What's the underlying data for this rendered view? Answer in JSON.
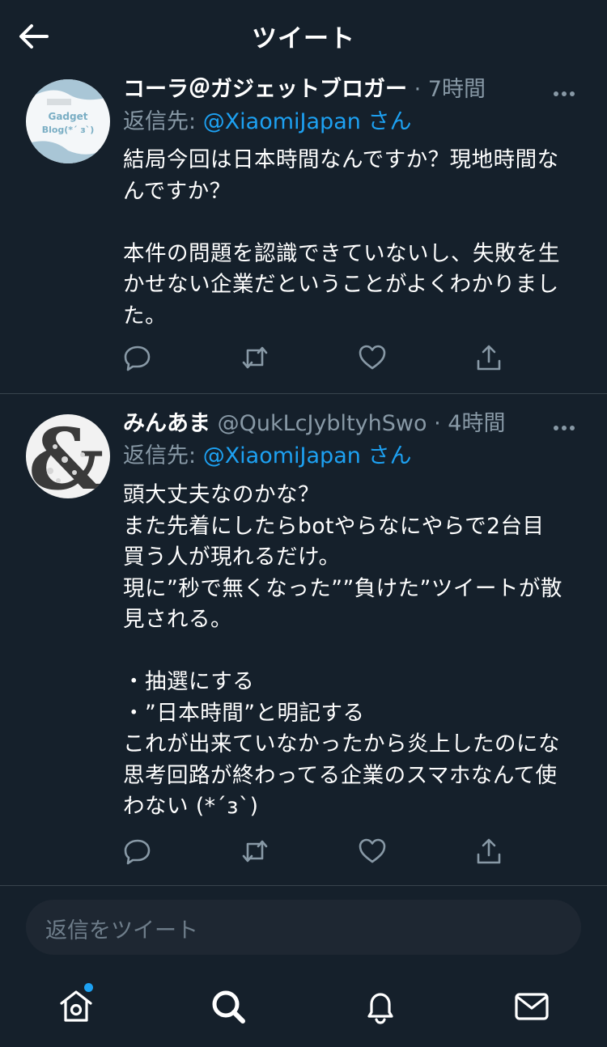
{
  "header": {
    "title": "ツイート"
  },
  "tweets": [
    {
      "name": "コーラ＠ガジェットブロガー",
      "handle": "",
      "dot": "·",
      "time": "7時間",
      "avatar_text": [
        "Gadget",
        "Blog(*´ з`)"
      ],
      "reply_prefix": "返信先: ",
      "reply_mention": "@XiaomiJapan",
      "reply_suffix": "さん",
      "lines": [
        "結局今回は日本時間なんですか？現地時間な",
        "んですか？",
        "",
        "本件の問題を認識できていないし、失敗を生",
        "かせない企業だということがよくわかりまし",
        "た。"
      ]
    },
    {
      "name": "みんあま",
      "handle": "@QukLcJybltyhSwo",
      "dot": "·",
      "time": "4時間",
      "avatar_text": [
        "&"
      ],
      "reply_prefix": "返信先: ",
      "reply_mention": "@XiaomiJapan",
      "reply_suffix": "さん",
      "lines": [
        "頭大丈夫なのかな？",
        "また先着にしたらbotやらなにやらで2台目",
        "買う人が現れるだけ。",
        "現に”秒で無くなった””負けた”ツイートが散",
        "見される。",
        "",
        "・抽選にする",
        "・”日本時間”と明記する",
        "これが出来ていなかったから炎上したのにな",
        "思考回路が終わってる企業のスマホなんて使",
        "わない (*´з`)"
      ]
    }
  ],
  "compose": {
    "placeholder": "返信をツイート"
  },
  "colors": {
    "background": "#15202b",
    "accent": "#1da1f2",
    "muted": "#8899a6"
  },
  "icons": [
    "back-arrow-icon",
    "more-icon",
    "reply-icon",
    "retweet-icon",
    "like-icon",
    "share-icon",
    "home-icon",
    "search-icon",
    "bell-icon",
    "mail-icon"
  ]
}
